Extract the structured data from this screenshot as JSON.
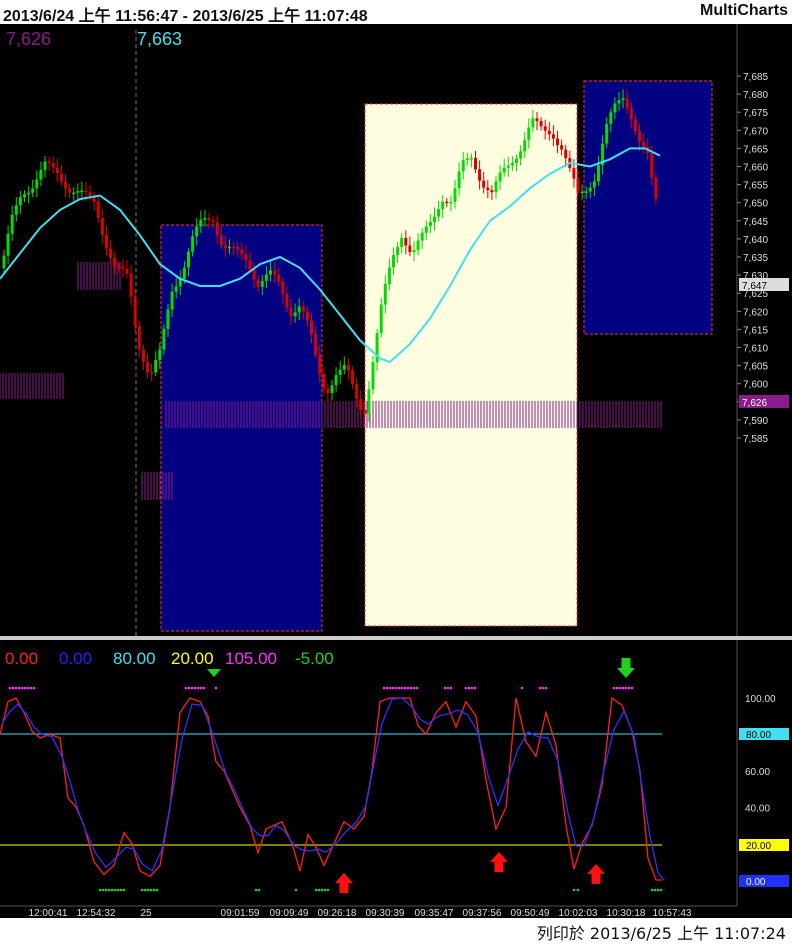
{
  "header": {
    "range_text": "2013/6/24  上午 11:56:47 - 2013/6/25  上午 11:07:48",
    "app_name": "MultiCharts"
  },
  "price_panel": {
    "readout_left": "7,626",
    "readout_right": "7,663",
    "readout_left_color": "#8b1a8b",
    "readout_right_color": "#40e0f0",
    "last_price_tag": "7,647",
    "marker_tag": "7,626",
    "y_ticks": [
      "7,685",
      "7,680",
      "7,675",
      "7,670",
      "7,665",
      "7,660",
      "7,655",
      "7,650",
      "7,645",
      "7,640",
      "7,635",
      "7,630",
      "7,625",
      "7,620",
      "7,615",
      "7,610",
      "7,605",
      "7,600",
      "7,595",
      "7,590",
      "7,585"
    ]
  },
  "indicator_panel": {
    "legend": [
      {
        "text": "0.00",
        "color": "#ff2020"
      },
      {
        "text": "0.00",
        "color": "#2020ff"
      },
      {
        "text": "80.00",
        "color": "#40e0f0"
      },
      {
        "text": "20.00",
        "color": "#ffff00"
      },
      {
        "text": "105.00",
        "color": "#ff30ff"
      },
      {
        "text": "-5.00",
        "color": "#20d020"
      }
    ],
    "y_ticks": [
      "100.00",
      "80.00",
      "60.00",
      "40.00",
      "20.00"
    ],
    "tag_upper": "80.00",
    "tag_lower": "20.00",
    "tag_value": "0.00"
  },
  "time_axis": [
    "12:00:41",
    "12:54:32",
    "25",
    "09:01:59",
    "09:09:49",
    "09:26:18",
    "09:30:39",
    "09:35:47",
    "09:37:56",
    "09:50:49",
    "10:02:03",
    "10:30:18",
    "10:57:43"
  ],
  "footer": {
    "print_text": "列印於  2013/6/25  上午 11:07:24"
  },
  "colors": {
    "background": "#000000",
    "up_candle": "#00dd00",
    "down_candle": "#dd0000",
    "moving_average": "#40e0f0",
    "box_blue": "#000080",
    "box_cream": "#fffde0",
    "volume_profile": "#8b1a8b",
    "stoch_k": "#ff2020",
    "stoch_d": "#2020ff"
  }
}
